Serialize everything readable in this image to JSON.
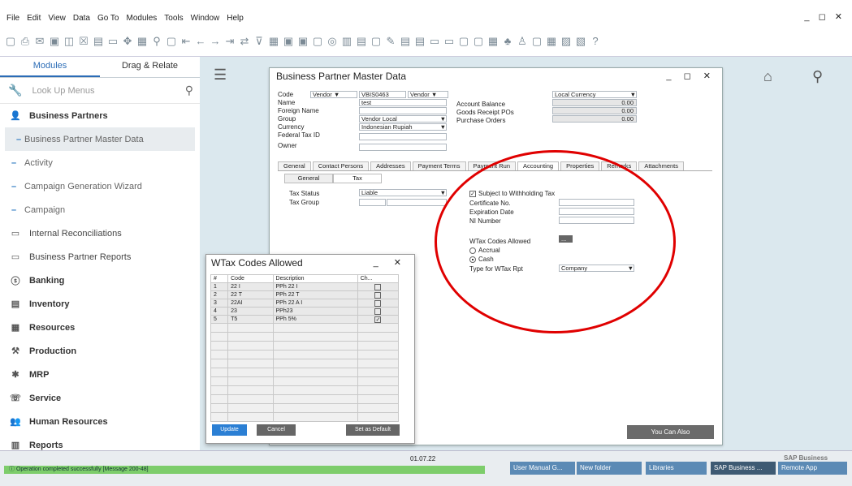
{
  "menu": [
    "File",
    "Edit",
    "View",
    "Data",
    "Go To",
    "Modules",
    "Tools",
    "Window",
    "Help"
  ],
  "sidebar": {
    "tab_modules": "Modules",
    "tab_drag": "Drag & Relate",
    "lookup": "Look Up Menus",
    "items": [
      {
        "label": "Business Partners",
        "kind": "bold",
        "icon": "👤"
      },
      {
        "label": "Business Partner Master Data",
        "kind": "sel"
      },
      {
        "label": "Activity",
        "kind": "sub"
      },
      {
        "label": "Campaign Generation Wizard",
        "kind": "sub"
      },
      {
        "label": "Campaign",
        "kind": "sub"
      },
      {
        "label": "Internal Reconciliations",
        "kind": "folder",
        "icon": "▭"
      },
      {
        "label": "Business Partner Reports",
        "kind": "folder",
        "icon": "▭"
      },
      {
        "label": "Banking",
        "kind": "bold",
        "icon": "ⓢ"
      },
      {
        "label": "Inventory",
        "kind": "bold",
        "icon": "▤"
      },
      {
        "label": "Resources",
        "kind": "bold",
        "icon": "▦"
      },
      {
        "label": "Production",
        "kind": "bold",
        "icon": "⚒"
      },
      {
        "label": "MRP",
        "kind": "bold",
        "icon": "✱"
      },
      {
        "label": "Service",
        "kind": "bold",
        "icon": "☏"
      },
      {
        "label": "Human Resources",
        "kind": "bold",
        "icon": "👥"
      },
      {
        "label": "Reports",
        "kind": "bold",
        "icon": "▥"
      }
    ]
  },
  "bp": {
    "title": "Business Partner Master Data",
    "code_label": "Code",
    "code_type": "Vendor",
    "code_value": "VBIS0463",
    "code_type2": "Vendor",
    "name_label": "Name",
    "name_value": "test",
    "foreign_label": "Foreign Name",
    "group_label": "Group",
    "group_value": "Vendor Local",
    "currency_label": "Currency",
    "currency_value": "Indonesian Rupiah",
    "fedtax_label": "Federal Tax ID",
    "owner_label": "Owner",
    "local_currency": "Local Currency",
    "acct_balance": "Account Balance",
    "acct_balance_v": "0.00",
    "goods_receipt": "Goods Receipt POs",
    "goods_receipt_v": "0.00",
    "purchase_orders": "Purchase Orders",
    "purchase_orders_v": "0.00",
    "tabs": [
      "General",
      "Contact Persons",
      "Addresses",
      "Payment Terms",
      "Payment Run",
      "Accounting",
      "Properties",
      "Remarks",
      "Attachments"
    ],
    "subtabs": [
      "General",
      "Tax"
    ],
    "tax_status_label": "Tax Status",
    "tax_status_value": "Liable",
    "tax_group_label": "Tax Group",
    "subject_wtax": "Subject to Withholding Tax",
    "cert_no": "Certificate No.",
    "exp_date": "Expiration Date",
    "ni_number": "NI Number",
    "wtax_codes": "WTax Codes Allowed",
    "wtax_btn": "...",
    "accrual": "Accrual",
    "cash": "Cash",
    "type_wtax_label": "Type for WTax Rpt",
    "type_wtax_value": "Company",
    "you_can_also": "You Can Also"
  },
  "wtax": {
    "title": "WTax Codes Allowed",
    "headers": [
      "#",
      "Code",
      "Description",
      "Ch..."
    ],
    "rows": [
      {
        "n": "1",
        "code": "22 I",
        "desc": "PPh 22 I",
        "checked": false
      },
      {
        "n": "2",
        "code": "22 T",
        "desc": "PPh 22 T",
        "checked": false
      },
      {
        "n": "3",
        "code": "22AI",
        "desc": "PPh 22 A I",
        "checked": false
      },
      {
        "n": "4",
        "code": "23",
        "desc": "PPh23",
        "checked": false
      },
      {
        "n": "5",
        "code": "T5",
        "desc": "PPh  5%",
        "checked": true
      }
    ],
    "update": "Update",
    "cancel": "Cancel",
    "set_default": "Set as Default"
  },
  "status": {
    "message": "Operation completed successfully  [Message 200-48]",
    "date": "01.07.22",
    "taskbar": [
      "User Manual G...",
      "New folder",
      "Libraries",
      "SAP Business ...",
      "Remote App"
    ],
    "brand": "SAP Business"
  }
}
